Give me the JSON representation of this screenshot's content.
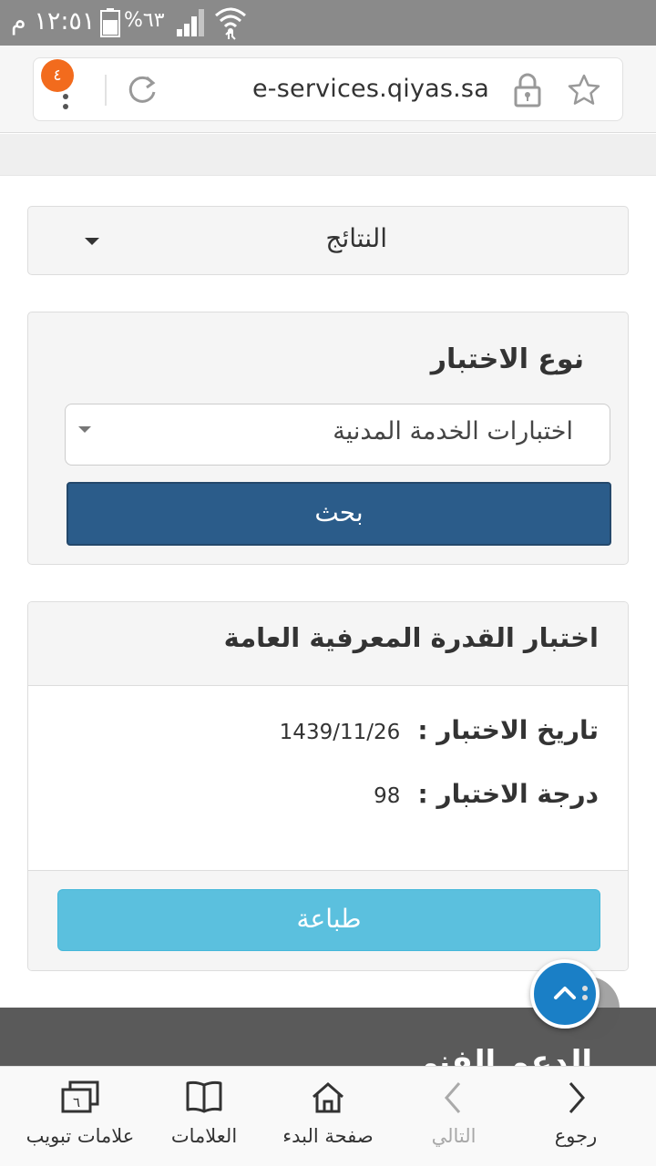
{
  "status_bar": {
    "time": "١٢:٥١ م",
    "battery": "%٦٣"
  },
  "browser": {
    "url": "e-services.qiyas.sa",
    "tab_count": "٤"
  },
  "page": {
    "results_dropdown": {
      "label": "النتائج"
    },
    "search_panel": {
      "test_type_label": "نوع الاختبار",
      "test_type_value": "اختبارات الخدمة المدنية",
      "search_button": "بحث"
    },
    "result_card": {
      "title": "اختبار القدرة المعرفية العامة",
      "test_date_label": "تاريخ الاختبار :",
      "test_date_value": "1439/11/26",
      "test_score_label": "درجة الاختبار :",
      "test_score_value": "98",
      "print_button": "طباعة"
    },
    "footer": {
      "heading": "الدعم الفني"
    }
  },
  "bottom_nav": {
    "back": "رجوع",
    "next": "التالي",
    "home": "صفحة البدء",
    "bookmarks": "العلامات",
    "tabs": "علامات تبويب",
    "tabs_count": "٦"
  },
  "colors": {
    "primary_button": "#2b5c8a",
    "print_button": "#5bc0de",
    "scroll_button": "#1a7fc6",
    "tab_badge": "#f26b1d",
    "footer_band": "#5a5a5a"
  }
}
